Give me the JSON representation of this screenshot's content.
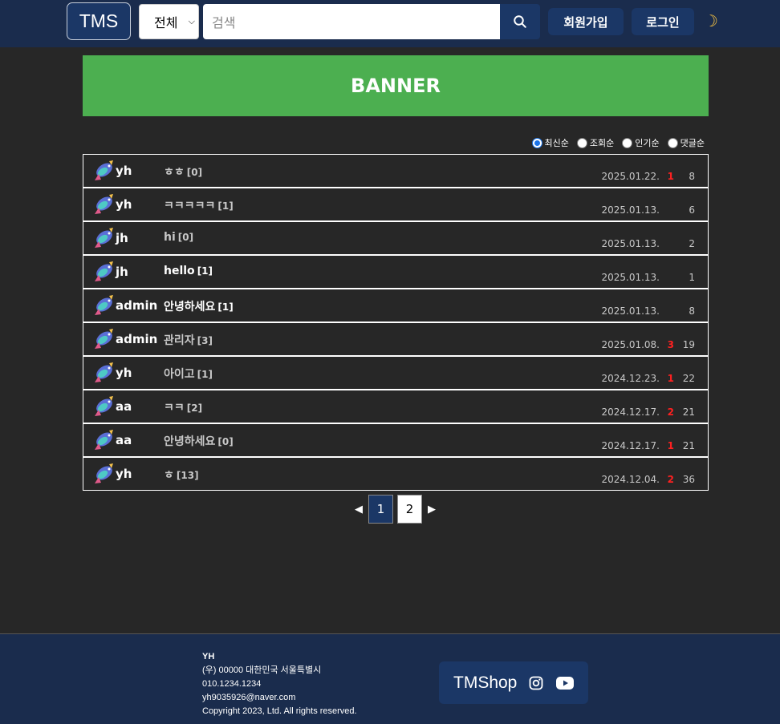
{
  "header": {
    "logo": "TMS",
    "scope": "전체",
    "search_placeholder": "검색",
    "signup": "회원가입",
    "login": "로그인"
  },
  "banner": {
    "text": "BANNER"
  },
  "sort": {
    "options": [
      "최신순",
      "조회순",
      "인기순",
      "댓글순"
    ],
    "selected": "최신순"
  },
  "posts": [
    {
      "author": "yh",
      "title": "ㅎㅎ",
      "comments": "[0]",
      "date": "2025.01.22.",
      "likes": "1",
      "views": "8",
      "bright": false
    },
    {
      "author": "yh",
      "title": "ㅋㅋㅋㅋㅋ",
      "comments": "[1]",
      "date": "2025.01.13.",
      "likes": "",
      "views": "6",
      "bright": false
    },
    {
      "author": "jh",
      "title": "hi",
      "comments": "[0]",
      "date": "2025.01.13.",
      "likes": "",
      "views": "2",
      "bright": false
    },
    {
      "author": "jh",
      "title": "hello",
      "comments": "[1]",
      "date": "2025.01.13.",
      "likes": "",
      "views": "1",
      "bright": true
    },
    {
      "author": "admin",
      "title": "안녕하세요",
      "comments": "[1]",
      "date": "2025.01.13.",
      "likes": "",
      "views": "8",
      "bright": true
    },
    {
      "author": "admin",
      "title": "관리자",
      "comments": "[3]",
      "date": "2025.01.08.",
      "likes": "3",
      "views": "19",
      "bright": false
    },
    {
      "author": "yh",
      "title": "아이고",
      "comments": "[1]",
      "date": "2024.12.23.",
      "likes": "1",
      "views": "22",
      "bright": false
    },
    {
      "author": "aa",
      "title": "ㅋㅋ",
      "comments": "[2]",
      "date": "2024.12.17.",
      "likes": "2",
      "views": "21",
      "bright": false
    },
    {
      "author": "aa",
      "title": "안녕하세요",
      "comments": "[0]",
      "date": "2024.12.17.",
      "likes": "1",
      "views": "21",
      "bright": false
    },
    {
      "author": "yh",
      "title": "ㅎ",
      "comments": "[13]",
      "date": "2024.12.04.",
      "likes": "2",
      "views": "36",
      "bright": false
    }
  ],
  "pagination": {
    "pages": [
      "1",
      "2"
    ],
    "current": "1"
  },
  "footer": {
    "lines": [
      "YH",
      "(우) 00000 대한민국 서울특별시",
      "010.1234.1234",
      "yh9035926@naver.com",
      "Copyright 2023, Ltd. All rights reserved."
    ],
    "brand": "TMShop"
  }
}
